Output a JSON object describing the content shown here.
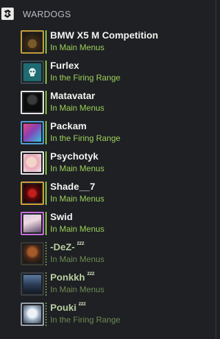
{
  "group": {
    "name": "WARDOGS"
  },
  "friends": [
    {
      "name": "BMW X5 M Competition",
      "status": "In Main Menus",
      "away": false
    },
    {
      "name": "Furlex",
      "status": "In the Firing Range",
      "away": false
    },
    {
      "name": "Matavatar",
      "status": "In Main Menus",
      "away": false
    },
    {
      "name": "Packam",
      "status": "In the Firing Range",
      "away": false
    },
    {
      "name": "Psychotyk",
      "status": "In Main Menus",
      "away": false
    },
    {
      "name": "Shade__7",
      "status": "In Main Menus",
      "away": false
    },
    {
      "name": "Swid",
      "status": "In Main Menus",
      "away": false
    },
    {
      "name": "-DeZ-",
      "status": "In Main Menus",
      "away": true,
      "away_mark": "zzz"
    },
    {
      "name": "Ponkkh",
      "status": "In Main Menus",
      "away": true,
      "away_mark": "zzz"
    },
    {
      "name": "Pouki",
      "status": "In the Firing Range",
      "away": true,
      "away_mark": "zzz"
    }
  ],
  "colors": {
    "background": "#1e2024",
    "in_game_green": "#8dc73f",
    "away_green": "#6f8a52"
  }
}
